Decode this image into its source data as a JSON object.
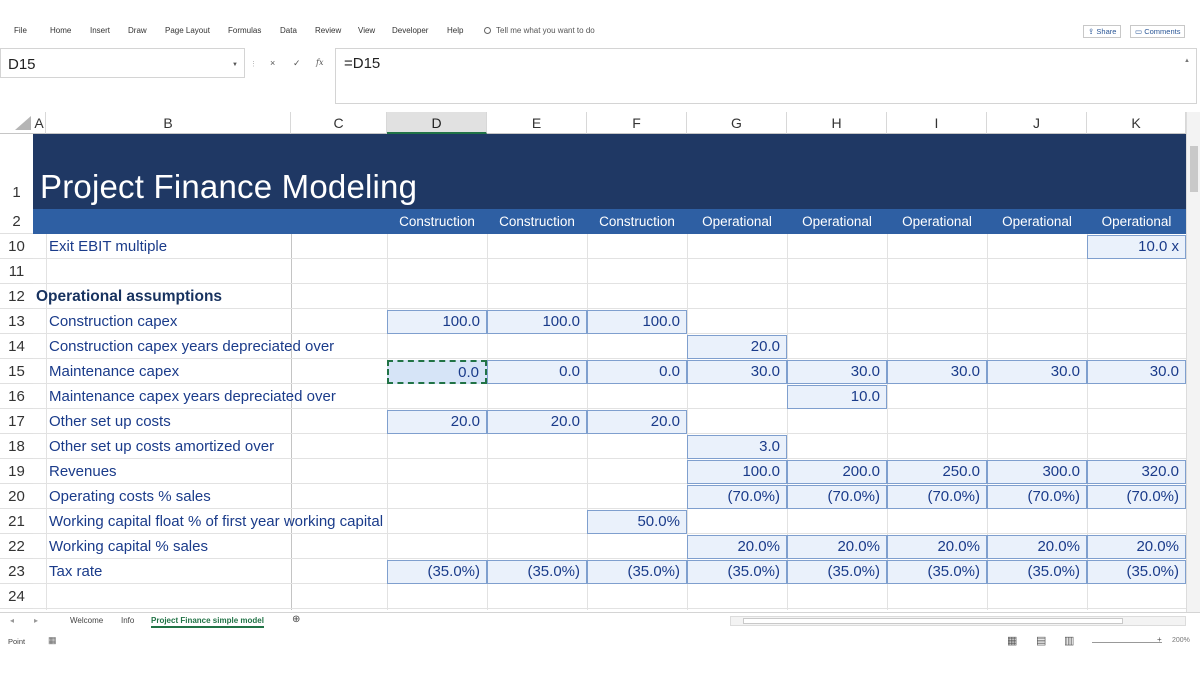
{
  "ribbon": {
    "tabs": [
      "File",
      "Home",
      "Insert",
      "Draw",
      "Page Layout",
      "Formulas",
      "Data",
      "Review",
      "View",
      "Developer",
      "Help"
    ],
    "tell_me": "Tell me what you want to do",
    "share": "Share",
    "comments": "Comments"
  },
  "formula_bar": {
    "name_box": "D15",
    "formula": "=D15",
    "cancel_icon": "×",
    "enter_icon": "✓",
    "fx_icon": "fx"
  },
  "columns": [
    "A",
    "B",
    "C",
    "D",
    "E",
    "F",
    "G",
    "H",
    "I",
    "J",
    "K"
  ],
  "selected_column": "D",
  "sheet": {
    "title": "Project Finance Modeling",
    "phase_row_number": "2",
    "title_row_number": "1",
    "phases": [
      "Construction",
      "Construction",
      "Construction",
      "Operational",
      "Operational",
      "Operational",
      "Operational",
      "Operational"
    ],
    "rows": [
      {
        "num": "10",
        "label": "Exit EBIT multiple",
        "values": [
          "",
          "",
          "",
          "",
          "",
          "",
          "",
          "10.0 x"
        ]
      },
      {
        "num": "11",
        "label": "",
        "values": [
          "",
          "",
          "",
          "",
          "",
          "",
          "",
          ""
        ]
      },
      {
        "num": "12",
        "label": "Operational assumptions",
        "section": true,
        "values": [
          "",
          "",
          "",
          "",
          "",
          "",
          "",
          ""
        ]
      },
      {
        "num": "13",
        "label": "Construction capex",
        "values": [
          "100.0",
          "100.0",
          "100.0",
          "",
          "",
          "",
          "",
          ""
        ]
      },
      {
        "num": "14",
        "label": "Construction capex years depreciated over",
        "values": [
          "",
          "",
          "",
          "20.0",
          "",
          "",
          "",
          ""
        ]
      },
      {
        "num": "15",
        "label": "Maintenance capex",
        "values": [
          "0.0",
          "0.0",
          "0.0",
          "30.0",
          "30.0",
          "30.0",
          "30.0",
          "30.0"
        ]
      },
      {
        "num": "16",
        "label": "Maintenance capex years depreciated over",
        "values": [
          "",
          "",
          "",
          "",
          "10.0",
          "",
          "",
          ""
        ]
      },
      {
        "num": "17",
        "label": "Other set up costs",
        "values": [
          "20.0",
          "20.0",
          "20.0",
          "",
          "",
          "",
          "",
          ""
        ]
      },
      {
        "num": "18",
        "label": "Other set up costs amortized over",
        "values": [
          "",
          "",
          "",
          "3.0",
          "",
          "",
          "",
          ""
        ]
      },
      {
        "num": "19",
        "label": "Revenues",
        "values": [
          "",
          "",
          "",
          "100.0",
          "200.0",
          "250.0",
          "300.0",
          "320.0"
        ]
      },
      {
        "num": "20",
        "label": "Operating costs % sales",
        "values": [
          "",
          "",
          "",
          "(70.0%)",
          "(70.0%)",
          "(70.0%)",
          "(70.0%)",
          "(70.0%)"
        ]
      },
      {
        "num": "21",
        "label": "Working capital float % of first year working capital",
        "values": [
          "",
          "",
          "50.0%",
          "",
          "",
          "",
          "",
          ""
        ]
      },
      {
        "num": "22",
        "label": "Working capital % sales",
        "values": [
          "",
          "",
          "",
          "20.0%",
          "20.0%",
          "20.0%",
          "20.0%",
          "20.0%"
        ]
      },
      {
        "num": "23",
        "label": "Tax rate",
        "values": [
          "(35.0%)",
          "(35.0%)",
          "(35.0%)",
          "(35.0%)",
          "(35.0%)",
          "(35.0%)",
          "(35.0%)",
          "(35.0%)"
        ]
      },
      {
        "num": "24",
        "label": "",
        "values": [
          "",
          "",
          "",
          "",
          "",
          "",
          "",
          ""
        ]
      }
    ]
  },
  "sheet_tabs": [
    "Welcome",
    "Info",
    "Project Finance simple model"
  ],
  "active_sheet": "Project Finance simple model",
  "status": {
    "mode": "Point",
    "zoom": "200%"
  },
  "colors": {
    "title_banner": "#1f3864",
    "phase_band": "#2e5fa3",
    "input_fill": "#eaf1fb",
    "input_text": "#1a3b8a",
    "excel_green": "#217346"
  }
}
